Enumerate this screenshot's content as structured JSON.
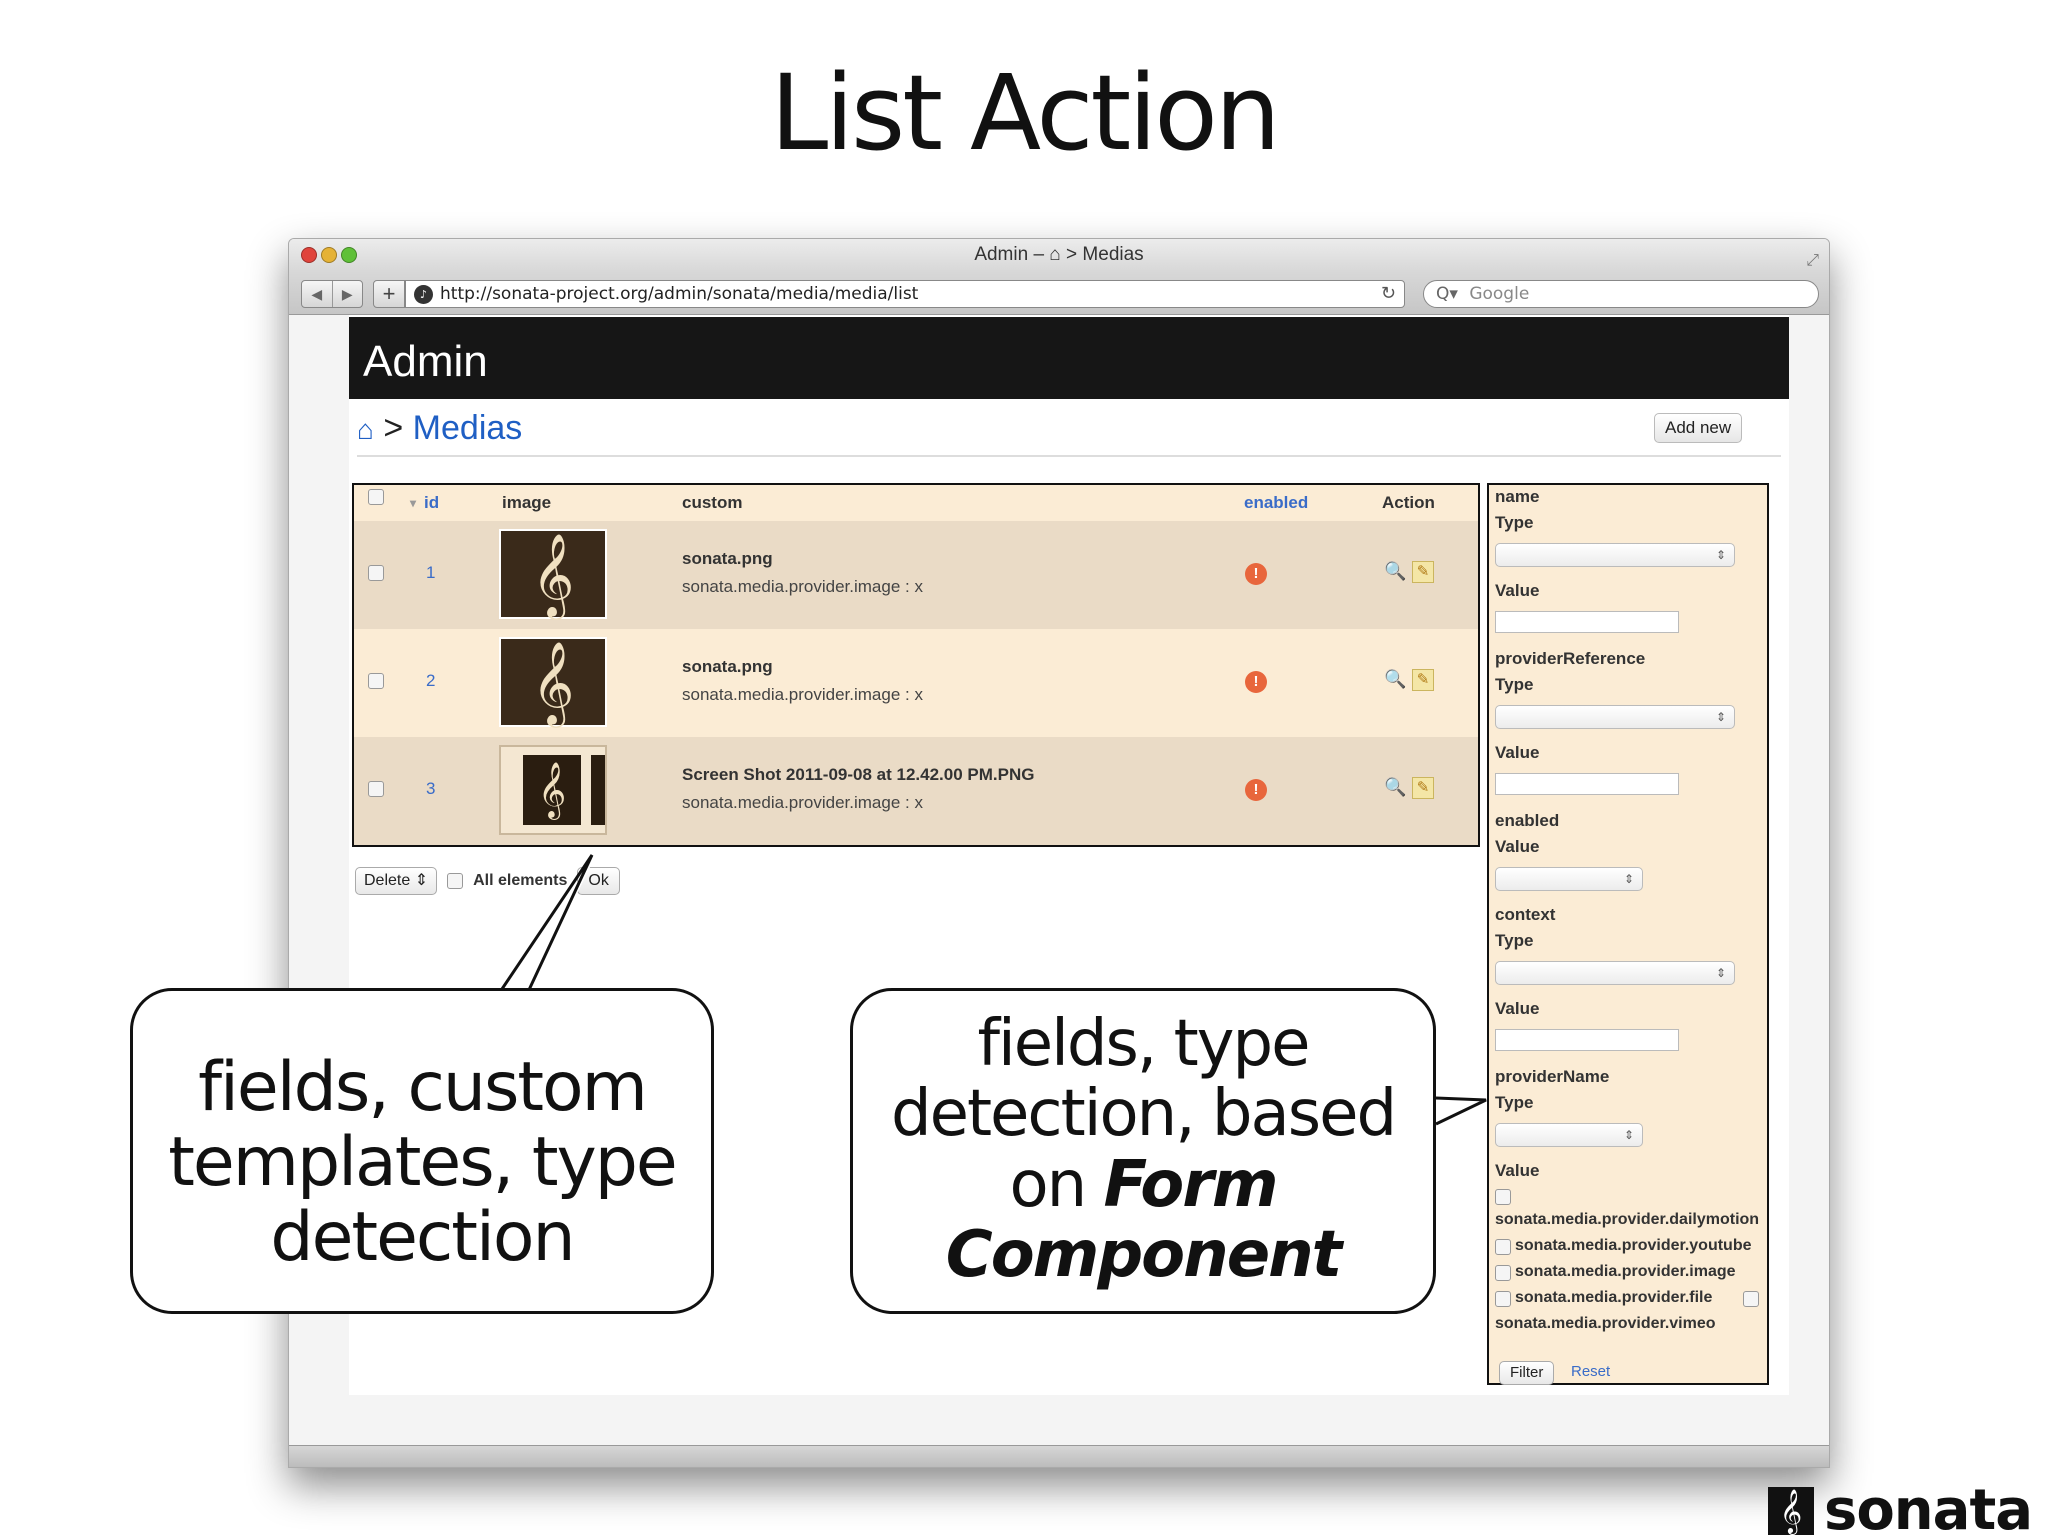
{
  "slide": {
    "title": "List Action"
  },
  "browser": {
    "window_title": "Admin – ⌂ > Medias",
    "url": "http://sonata-project.org/admin/sonata/media/media/list",
    "search_placeholder": "Google",
    "back_icon": "◀",
    "forward_icon": "▶",
    "add_tab_icon": "+",
    "reload_icon": "↻",
    "search_icon": "Q▾"
  },
  "admin": {
    "header_title": "Admin",
    "breadcrumb": {
      "home_icon": "⌂",
      "separator": " > ",
      "current": "Medias"
    },
    "add_new_label": "Add new"
  },
  "list": {
    "columns": {
      "id": "id",
      "image": "image",
      "custom": "custom",
      "enabled": "enabled",
      "action": "Action"
    },
    "sort_icon": "▾",
    "rows": [
      {
        "id": "1",
        "name": "sonata.png",
        "provider": "sonata.media.provider.image : x",
        "status_icon": "!",
        "show_icon": "🔍",
        "edit_icon": "✎"
      },
      {
        "id": "2",
        "name": "sonata.png",
        "provider": "sonata.media.provider.image : x",
        "status_icon": "!",
        "show_icon": "🔍",
        "edit_icon": "✎"
      },
      {
        "id": "3",
        "name": "Screen Shot 2011-09-08 at 12.42.00 PM.PNG",
        "provider": "sonata.media.provider.image : x",
        "status_icon": "!",
        "show_icon": "🔍",
        "edit_icon": "✎"
      }
    ],
    "thumb_glyph": "𝄞",
    "batch": {
      "action": "Delete",
      "select_arrows": "⇕",
      "all_elements": "All elements",
      "ok": "Ok"
    }
  },
  "filters": {
    "select_arrows": "⇕",
    "name": {
      "label": "name",
      "type_label": "Type",
      "value_label": "Value"
    },
    "providerReference": {
      "label": "providerReference",
      "type_label": "Type",
      "value_label": "Value"
    },
    "enabled": {
      "label": "enabled",
      "value_label": "Value"
    },
    "context": {
      "label": "context",
      "type_label": "Type",
      "value_label": "Value"
    },
    "providerName": {
      "label": "providerName",
      "type_label": "Type",
      "value_label": "Value",
      "options": [
        "sonata.media.provider.dailymotion",
        "sonata.media.provider.youtube",
        "sonata.media.provider.image",
        "sonata.media.provider.file",
        "sonata.media.provider.vimeo"
      ]
    },
    "filter_button": "Filter",
    "reset_link": "Reset"
  },
  "callouts": {
    "left": [
      "fields, custom",
      "templates, type",
      "detection"
    ],
    "right": {
      "line1": "fields, type",
      "line2": "detection, based",
      "line3": "on ",
      "line3_bold": "Form",
      "line4_bold": "Component"
    }
  },
  "logo": {
    "mark": "𝄞",
    "text": "sonata"
  }
}
